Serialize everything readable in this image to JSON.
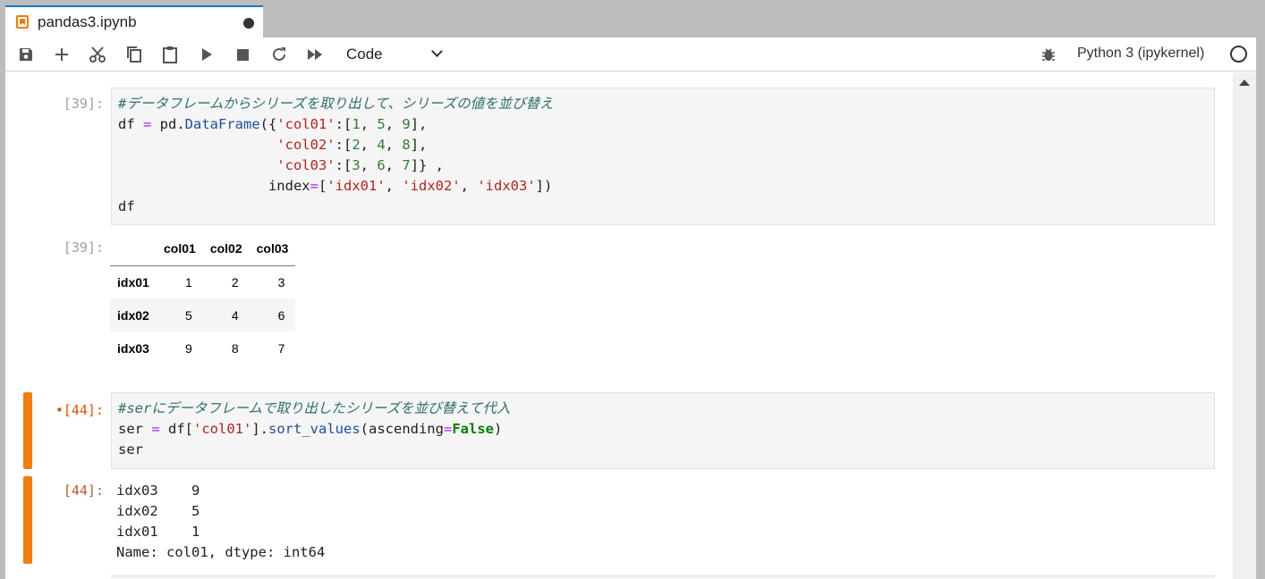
{
  "tab": {
    "title": "pandas3.ipynb"
  },
  "toolbar": {
    "cell_type": "Code",
    "kernel": "Python 3 (ipykernel)"
  },
  "cells": [
    {
      "in_prompt": "[39]:",
      "code_lines": [
        "#データフレームからシリーズを取り出して、シリーズの値を並び替え",
        "df = pd.DataFrame({'col01':[1, 5, 9],",
        "                   'col02':[2, 4, 8],",
        "                   'col03':[3, 6, 7]} ,",
        "                  index=['idx01', 'idx02', 'idx03'])",
        "df"
      ],
      "out_prompt": "[39]:",
      "table": {
        "columns": [
          "col01",
          "col02",
          "col03"
        ],
        "rows": [
          {
            "index": "idx01",
            "values": [
              "1",
              "2",
              "3"
            ]
          },
          {
            "index": "idx02",
            "values": [
              "5",
              "4",
              "6"
            ]
          },
          {
            "index": "idx03",
            "values": [
              "9",
              "8",
              "7"
            ]
          }
        ]
      }
    },
    {
      "in_prompt": "•[44]:",
      "code_lines": [
        "#serにデータフレームで取り出したシリーズを並び替えて代入",
        "ser = df['col01'].sort_values(ascending=False)",
        "ser"
      ],
      "out_prompt": "[44]:",
      "output_lines": [
        "idx03    9",
        "idx02    5",
        "idx01    1",
        "Name: col01, dtype: int64"
      ]
    }
  ],
  "colors": {
    "accent": "#f57d0d",
    "tab_border": "#1976d2"
  }
}
